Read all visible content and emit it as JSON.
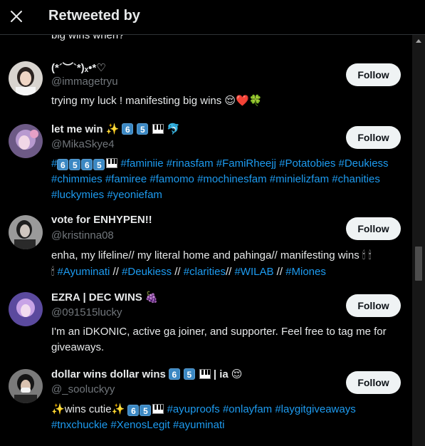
{
  "header": {
    "title": "Retweeted by"
  },
  "peek_text": "big wins when?",
  "follow_label": "Follow",
  "users": [
    {
      "name": "(*´︶`*)ₓ•*♡",
      "handle": "@immagetryu",
      "bio": "trying my luck ! manifesting big wins 😌❤️🍀"
    },
    {
      "name": "let me win ✨",
      "handle": "@MikaSkye4",
      "bio_tags_line1": "#faminiie #rinasfam #FamiRheejj #Potatobies #Deukiess",
      "bio_tags_line2": "#chimmies #famiree #famomo #mochinesfam #minielizfam #chanities",
      "bio_tags_line3": "#luckymies #yeoniefam"
    },
    {
      "name": "vote for ENHYPEN!!",
      "handle": "@kristinna08",
      "bio_line1": "enha, my lifeline// my literal home and pahinga// manifesting wins",
      "bio_tags": [
        "#Ayuminati",
        "#Deukiess",
        "#clarities",
        "#WILAB",
        "#Miones"
      ]
    },
    {
      "name": "EZRA | DEC WINS",
      "handle": "@091515lucky",
      "bio": "I'm an iDKONIC, active ga joiner, and supporter. Feel free to tag me for giveaways."
    },
    {
      "name": "dollar wins dollar wins",
      "name_suffix": "| ia",
      "handle": "@_sooluckyy",
      "bio_prefix": "wins cutie",
      "bio_tags_line1": "#ayuproofs #onlayfam #laygitgiveaways",
      "bio_tags_line2": "#tnxchuckie #XenosLegit #ayuminati"
    }
  ],
  "colors": {
    "accent": "#1d9bf0",
    "bg": "#000000",
    "muted": "#71767b"
  }
}
